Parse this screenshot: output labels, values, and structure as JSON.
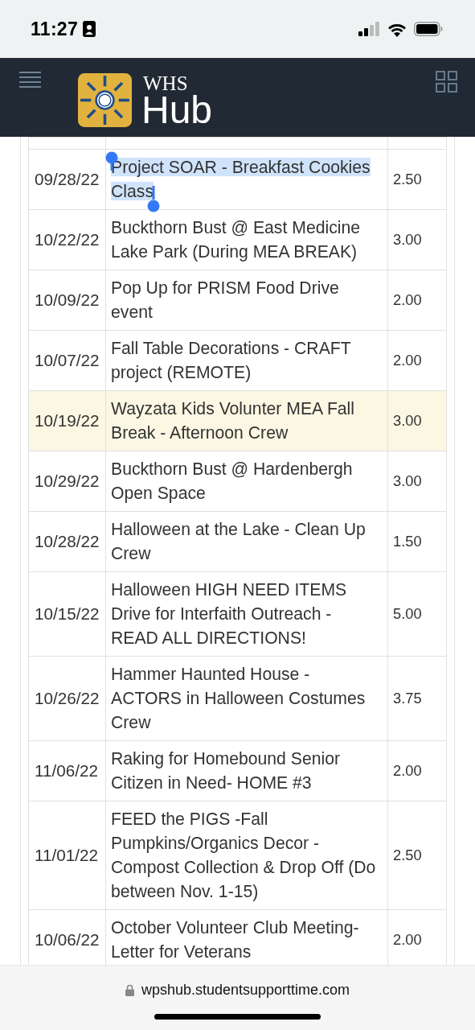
{
  "status_bar": {
    "time": "11:27"
  },
  "header": {
    "logo_top": "WHS",
    "logo_bottom": "Hub"
  },
  "table": {
    "rows": [
      {
        "date": "09/28/22",
        "title": "Project SOAR - Breakfast Cookies Class",
        "hours": "2.50",
        "highlighted": false,
        "text_selected": true
      },
      {
        "date": "10/22/22",
        "title": "Buckthorn Bust @ East Medicine Lake Park (During MEA BREAK)",
        "hours": "3.00",
        "highlighted": false,
        "text_selected": false
      },
      {
        "date": "10/09/22",
        "title": "Pop Up for PRISM Food Drive event",
        "hours": "2.00",
        "highlighted": false,
        "text_selected": false
      },
      {
        "date": "10/07/22",
        "title": "Fall Table Decorations - CRAFT project (REMOTE)",
        "hours": "2.00",
        "highlighted": false,
        "text_selected": false
      },
      {
        "date": "10/19/22",
        "title": "Wayzata Kids Volunter MEA Fall Break - Afternoon Crew",
        "hours": "3.00",
        "highlighted": true,
        "text_selected": false
      },
      {
        "date": "10/29/22",
        "title": "Buckthorn Bust @ Hardenbergh Open Space",
        "hours": "3.00",
        "highlighted": false,
        "text_selected": false
      },
      {
        "date": "10/28/22",
        "title": "Halloween at the Lake - Clean Up Crew",
        "hours": "1.50",
        "highlighted": false,
        "text_selected": false
      },
      {
        "date": "10/15/22",
        "title": "Halloween HIGH NEED ITEMS Drive for Interfaith Outreach - READ ALL DIRECTIONS!",
        "hours": "5.00",
        "highlighted": false,
        "text_selected": false
      },
      {
        "date": "10/26/22",
        "title": "Hammer Haunted House - ACTORS in Halloween Costumes Crew",
        "hours": "3.75",
        "highlighted": false,
        "text_selected": false
      },
      {
        "date": "11/06/22",
        "title": "Raking for Homebound Senior Citizen in Need- HOME #3",
        "hours": "2.00",
        "highlighted": false,
        "text_selected": false
      },
      {
        "date": "11/01/22",
        "title": "FEED the PIGS -Fall Pumpkins/Organics Decor - Compost Collection & Drop Off (Do between Nov. 1-15)",
        "hours": "2.50",
        "highlighted": false,
        "text_selected": false
      },
      {
        "date": "10/06/22",
        "title": "October Volunteer Club Meeting- Letter for Veterans",
        "hours": "2.00",
        "highlighted": false,
        "text_selected": false
      }
    ]
  },
  "browser_bar": {
    "url": "wpshub.studentsupporttime.com"
  }
}
